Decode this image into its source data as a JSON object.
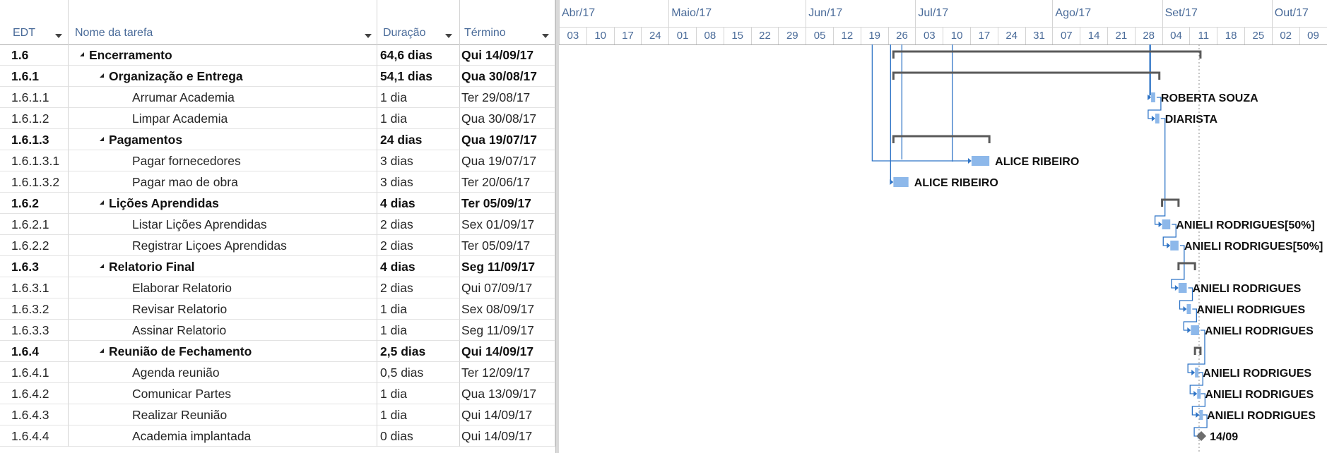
{
  "columns": {
    "edt": "EDT",
    "name": "Nome da tarefa",
    "duration": "Duração",
    "finish": "Término"
  },
  "timescale": {
    "months": [
      "Abr/17",
      "Maio/17",
      "Jun/17",
      "Jul/17",
      "Ago/17",
      "Set/17",
      "Out/17"
    ],
    "weeks": [
      "03",
      "10",
      "17",
      "24",
      "01",
      "08",
      "15",
      "22",
      "29",
      "05",
      "12",
      "19",
      "26",
      "03",
      "10",
      "17",
      "24",
      "31",
      "07",
      "14",
      "21",
      "28",
      "04",
      "11",
      "18",
      "25",
      "02",
      "09"
    ]
  },
  "colors": {
    "bar": "#8db8ea",
    "summary_bracket": "#5a5a5a",
    "link": "#2f74c6",
    "milestone": "#6d6d6d",
    "header_text": "#4a6b99",
    "status_date_line": "#8c8c8c"
  },
  "tasks": [
    {
      "edt": "1.6",
      "name": "Encerramento",
      "duration": "64,6 dias",
      "finish": "Qui 14/09/17",
      "level": 1,
      "summary": true,
      "start_week": 12.2,
      "end_week": 23.4
    },
    {
      "edt": "1.6.1",
      "name": "Organização e Entrega",
      "duration": "54,1 dias",
      "finish": "Qua 30/08/17",
      "level": 2,
      "summary": true,
      "start_week": 12.2,
      "end_week": 21.9
    },
    {
      "edt": "1.6.1.1",
      "name": "Arrumar Academia",
      "duration": "1 dia",
      "finish": "Ter 29/08/17",
      "level": 3,
      "summary": false,
      "start_week": 21.6,
      "end_week": 21.75,
      "resource": "ROBERTA SOUZA"
    },
    {
      "edt": "1.6.1.2",
      "name": "Limpar Academia",
      "duration": "1 dia",
      "finish": "Qua 30/08/17",
      "level": 3,
      "summary": false,
      "start_week": 21.75,
      "end_week": 21.9,
      "resource": "DIARISTA"
    },
    {
      "edt": "1.6.1.3",
      "name": "Pagamentos",
      "duration": "24 dias",
      "finish": "Qua 19/07/17",
      "level": 2,
      "summary": true,
      "start_week": 12.2,
      "end_week": 15.7
    },
    {
      "edt": "1.6.1.3.1",
      "name": "Pagar fornecedores",
      "duration": "3 dias",
      "finish": "Qua 19/07/17",
      "level": 3,
      "summary": false,
      "start_week": 15.05,
      "end_week": 15.7,
      "resource": "ALICE RIBEIRO"
    },
    {
      "edt": "1.6.1.3.2",
      "name": "Pagar mao de obra",
      "duration": "3 dias",
      "finish": "Ter 20/06/17",
      "level": 3,
      "summary": false,
      "start_week": 12.2,
      "end_week": 12.75,
      "resource": "ALICE RIBEIRO"
    },
    {
      "edt": "1.6.2",
      "name": "Lições Aprendidas",
      "duration": "4 dias",
      "finish": "Ter 05/09/17",
      "level": 2,
      "summary": true,
      "start_week": 22.0,
      "end_week": 22.6
    },
    {
      "edt": "1.6.2.1",
      "name": "Listar Lições Aprendidas",
      "duration": "2 dias",
      "finish": "Sex 01/09/17",
      "level": 3,
      "summary": false,
      "start_week": 22.0,
      "end_week": 22.3,
      "resource": "ANIELI RODRIGUES[50%]"
    },
    {
      "edt": "1.6.2.2",
      "name": "Registrar Liçoes Aprendidas",
      "duration": "2 dias",
      "finish": "Ter 05/09/17",
      "level": 3,
      "summary": false,
      "start_week": 22.3,
      "end_week": 22.6,
      "resource": "ANIELI RODRIGUES[50%]"
    },
    {
      "edt": "1.6.3",
      "name": "Relatorio Final",
      "duration": "4 dias",
      "finish": "Seg 11/09/17",
      "level": 2,
      "summary": true,
      "start_week": 22.6,
      "end_week": 23.2
    },
    {
      "edt": "1.6.3.1",
      "name": "Elaborar Relatorio",
      "duration": "2 dias",
      "finish": "Qui 07/09/17",
      "level": 3,
      "summary": false,
      "start_week": 22.6,
      "end_week": 22.9,
      "resource": "ANIELI RODRIGUES"
    },
    {
      "edt": "1.6.3.2",
      "name": "Revisar Relatorio",
      "duration": "1 dia",
      "finish": "Sex 08/09/17",
      "level": 3,
      "summary": false,
      "start_week": 22.9,
      "end_week": 23.05,
      "resource": "ANIELI RODRIGUES"
    },
    {
      "edt": "1.6.3.3",
      "name": "Assinar Relatorio",
      "duration": "1 dia",
      "finish": "Seg 11/09/17",
      "level": 3,
      "summary": false,
      "start_week": 23.05,
      "end_week": 23.35,
      "resource": "ANIELI RODRIGUES"
    },
    {
      "edt": "1.6.4",
      "name": "Reunião de Fechamento",
      "duration": "2,5 dias",
      "finish": "Qui 14/09/17",
      "level": 2,
      "summary": true,
      "start_week": 23.2,
      "end_week": 23.4
    },
    {
      "edt": "1.6.4.1",
      "name": "Agenda reunião",
      "duration": "0,5 dias",
      "finish": "Ter 12/09/17",
      "level": 3,
      "summary": false,
      "start_week": 23.2,
      "end_week": 23.28,
      "resource": "ANIELI RODRIGUES"
    },
    {
      "edt": "1.6.4.2",
      "name": "Comunicar Partes",
      "duration": "1 dia",
      "finish": "Qua 13/09/17",
      "level": 3,
      "summary": false,
      "start_week": 23.28,
      "end_week": 23.36,
      "resource": "ANIELI RODRIGUES"
    },
    {
      "edt": "1.6.4.3",
      "name": "Realizar Reunião",
      "duration": "1 dia",
      "finish": "Qui 14/09/17",
      "level": 3,
      "summary": false,
      "start_week": 23.36,
      "end_week": 23.43,
      "resource": "ANIELI RODRIGUES"
    },
    {
      "edt": "1.6.4.4",
      "name": "Academia implantada",
      "duration": "0 dias",
      "finish": "Qui 14/09/17",
      "level": 3,
      "summary": false,
      "milestone": true,
      "start_week": 23.43,
      "end_week": 23.43,
      "resource": "14/09"
    }
  ],
  "status_date_week": 23.35
}
